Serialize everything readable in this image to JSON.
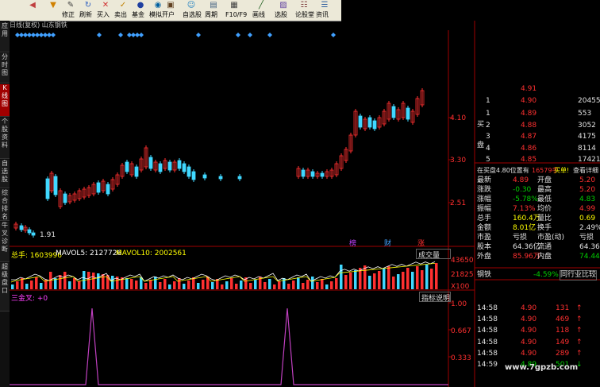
{
  "toolbar": {
    "buttons": [
      {
        "icon": "arrow-left-icon",
        "label": ""
      },
      {
        "icon": "arrow-down-icon",
        "label": ""
      },
      {
        "icon": "edit-icon",
        "label": "修正"
      },
      {
        "icon": "refresh-icon",
        "label": "刷新"
      },
      {
        "icon": "buy-icon",
        "label": "买入"
      },
      {
        "icon": "sell-icon",
        "label": "卖出"
      },
      {
        "icon": "fund-icon",
        "label": "基金"
      },
      {
        "icon": "simulate-icon",
        "label": "模拟"
      },
      {
        "icon": "open-icon",
        "label": "开户"
      },
      {
        "icon": "user-icon",
        "label": "自选股"
      },
      {
        "icon": "period-icon",
        "label": "周期"
      },
      {
        "icon": "f10-icon",
        "label": "F10/F9"
      },
      {
        "icon": "line-icon",
        "label": "画线"
      },
      {
        "icon": "select-stock-icon",
        "label": "选股"
      },
      {
        "icon": "forum-icon",
        "label": "论股堂"
      },
      {
        "icon": "news-icon",
        "label": "资讯"
      }
    ]
  },
  "sidebar": {
    "tabs": [
      "应用",
      "分时图",
      "K线图",
      "个股资料",
      "自选股",
      "综合排名",
      "牛叉诊断",
      "超级盘口"
    ]
  },
  "chart_header": {
    "title": "日线(复权) 山东钢铁"
  },
  "kline": {
    "axis_labels": [
      "4.10",
      "3.30",
      "2.51"
    ],
    "low_label": "1.91",
    "markers": [
      "榜",
      "财",
      "涨"
    ]
  },
  "volume": {
    "label_total": "总手: 1603996",
    "label_ma5": "MAVOL5: 2127726",
    "label_ma10": "MAVOL10: 2002561",
    "dropdown": "成交量",
    "axis_top": "43650",
    "axis_mid": "21825",
    "axis_unit": "X100"
  },
  "indicator": {
    "label": "三金叉: +0",
    "button": "指标说明",
    "axis": [
      "1.00",
      "0.667",
      "0.333"
    ]
  },
  "quote": {
    "top_price": "4.91",
    "sell": [
      {
        "level": "1",
        "price": "4.90",
        "vol": "20455"
      }
    ],
    "buy_label": [
      "买",
      "盘"
    ],
    "buy": [
      {
        "level": "1",
        "price": "4.89",
        "vol": "553"
      },
      {
        "level": "2",
        "price": "4.88",
        "vol": "3052"
      },
      {
        "level": "3",
        "price": "4.87",
        "vol": "4175"
      },
      {
        "level": "4",
        "price": "4.86",
        "vol": "8114"
      },
      {
        "level": "5",
        "price": "4.85",
        "vol": "17421"
      }
    ],
    "notice": "在买盘4.80位置有",
    "notice2": "16579手",
    "notice3": "买单!",
    "notice_link": "查看详细",
    "stats": [
      {
        "k1": "最新",
        "v1": "4.89",
        "k2": "开盘",
        "v2": "5.20"
      },
      {
        "k1": "涨跌",
        "v1": "-0.30",
        "k2": "最高",
        "v2": "5.20"
      },
      {
        "k1": "涨幅",
        "v1": "-5.78%",
        "k2": "最低",
        "v2": "4.83"
      },
      {
        "k1": "振幅",
        "v1": "7.13%",
        "k2": "均价",
        "v2": "4.99"
      },
      {
        "k1": "总手",
        "v1": "160.4万",
        "k2": "量比",
        "v2": "0.69"
      },
      {
        "k1": "金额",
        "v1": "8.01亿",
        "k2": "换手",
        "v2": "2.49%"
      },
      {
        "k1": "市盈",
        "v1": "亏损",
        "k2": "市盈(动)",
        "v2": "亏损"
      },
      {
        "k1": "股本",
        "v1": "64.36亿",
        "k2": "流通",
        "v2": "64.36亿"
      },
      {
        "k1": "外盘",
        "v1": "85.96万",
        "k2": "内盘",
        "v2": "74.44万"
      }
    ],
    "stock_name": "钢铁",
    "stock_pct": "-4.59%",
    "compare_btn": "同行业比较",
    "ticks": [
      {
        "t": "14:58",
        "p": "4.90",
        "v": "131"
      },
      {
        "t": "14:58",
        "p": "4.90",
        "v": "469"
      },
      {
        "t": "14:58",
        "p": "4.90",
        "v": "118"
      },
      {
        "t": "14:58",
        "p": "4.90",
        "v": "149"
      },
      {
        "t": "14:58",
        "p": "4.90",
        "v": "289"
      },
      {
        "t": "14:59",
        "p": "4.89",
        "v": "501"
      }
    ],
    "watermark": "www.7gpzb.com"
  },
  "colors": {
    "up": "#ff3030",
    "down": "#40d8ff",
    "ma5": "#ffffff",
    "ma10": "#ffff00",
    "indicator": "#c040c0"
  }
}
